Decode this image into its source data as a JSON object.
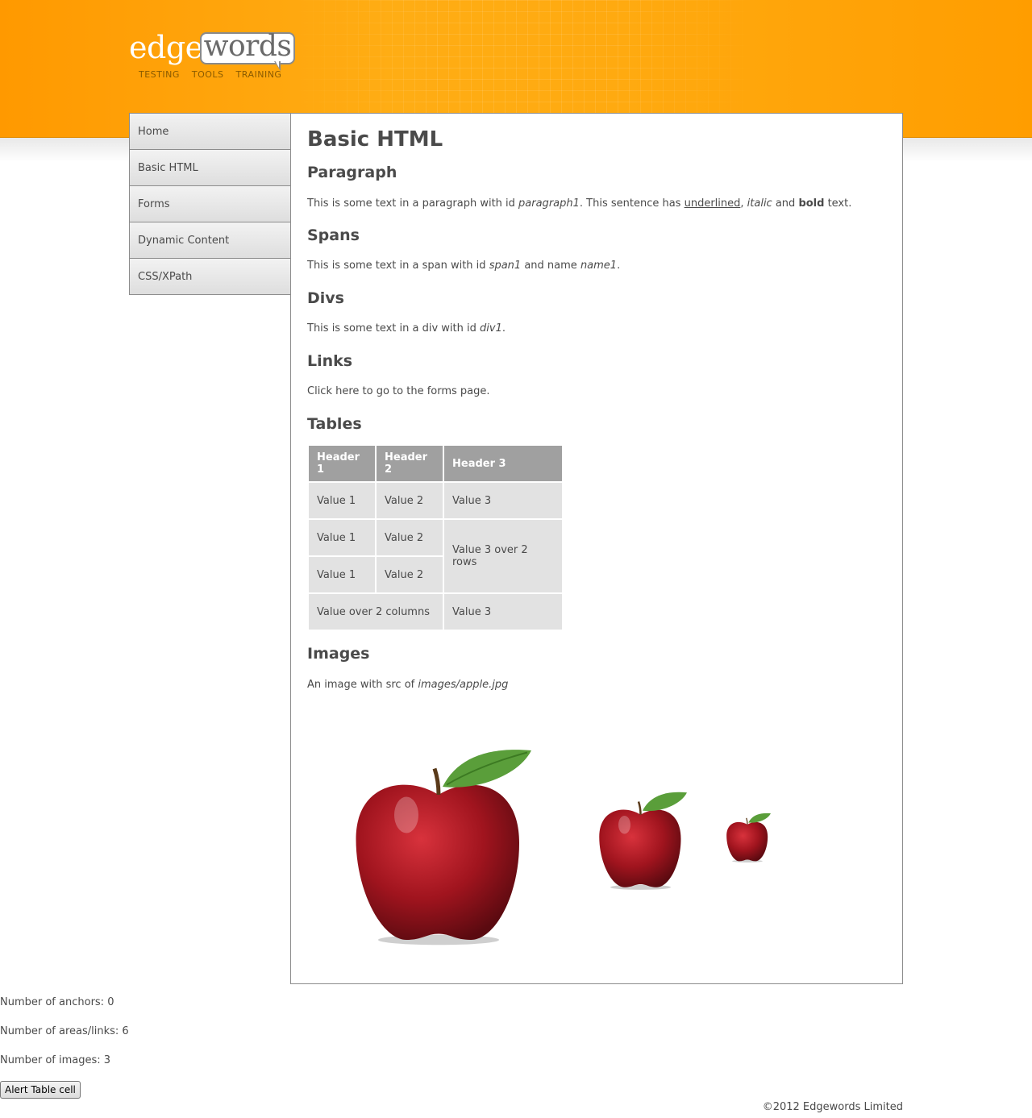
{
  "logo": {
    "edge": "edge",
    "words": "words",
    "tagline": [
      "TESTING",
      "TOOLS",
      "TRAINING"
    ]
  },
  "nav": {
    "items": [
      {
        "label": "Home"
      },
      {
        "label": "Basic HTML"
      },
      {
        "label": "Forms"
      },
      {
        "label": "Dynamic Content"
      },
      {
        "label": "CSS/XPath"
      }
    ]
  },
  "main": {
    "title": "Basic HTML",
    "paragraph": {
      "heading": "Paragraph",
      "t1": "This is some text in a paragraph with id ",
      "id": "paragraph1",
      "t2": ". This sentence has ",
      "underlined": "underlined",
      "t3": ", ",
      "italic": "italic",
      "t4": " and ",
      "bold": "bold",
      "t5": " text."
    },
    "spans": {
      "heading": "Spans",
      "t1": "This is some text in a span with id ",
      "id": "span1",
      "t2": " and name ",
      "name": "name1",
      "t3": "."
    },
    "divs": {
      "heading": "Divs",
      "t1": "This is some text in a div with id ",
      "id": "div1",
      "t2": "."
    },
    "links": {
      "heading": "Links",
      "t1": "Click ",
      "link": "here",
      "t2": " to go to the forms page."
    },
    "tables": {
      "heading": "Tables",
      "headers": [
        "Header 1",
        "Header 2",
        "Header 3"
      ],
      "r1": [
        "Value 1",
        "Value 2",
        "Value 3"
      ],
      "r2": [
        "Value 1",
        "Value 2",
        "Value 3 over 2 rows"
      ],
      "r3": [
        "Value 1",
        "Value 2"
      ],
      "r4": [
        "Value over 2 columns",
        "Value 3"
      ]
    },
    "images": {
      "heading": "Images",
      "t1": "An image with src of ",
      "src": "images/apple.jpg"
    }
  },
  "info": {
    "anchors": "Number of anchors: 0",
    "areas": "Number of areas/links: 6",
    "images": "Number of images: 3"
  },
  "alert_button": "Alert Table cell",
  "copyright": "©2012 Edgewords Limited",
  "colors": {
    "header_orange": "#ffa10a",
    "nav_border": "#8c8c8c",
    "table_header": "#a0a0a0",
    "table_cell": "#e2e2e2",
    "text": "#4a4a4a"
  }
}
